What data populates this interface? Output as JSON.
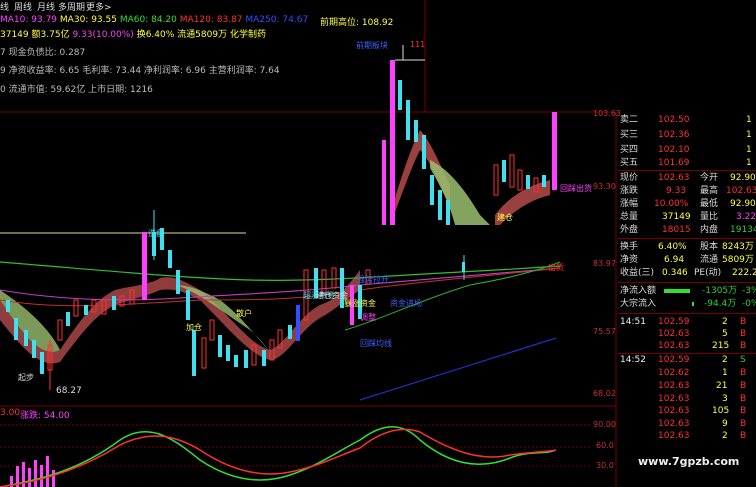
{
  "topbar": {
    "tab_minute": "线",
    "tab_week": "周线",
    "tab_month": "月线",
    "tab_multi": "多周期",
    "tab_more": "更多>"
  },
  "ma_line": {
    "ma10": "MA10: 93.79",
    "ma30": "MA30: 93.55",
    "ma60": "MA60: 84.20",
    "ma120": "MA120: 83.87",
    "ma250": "MA250: 74.67",
    "prev_high": "前期高位: 108.92"
  },
  "info_line": {
    "vol": "37149",
    "amt": "额3.75亿",
    "chg": "9.33(10.00%)",
    "turn": "换6.40%",
    "float": "流通5809万",
    "sector": "化学制药"
  },
  "fin": {
    "line1": "7 现金负债比: 0.287",
    "line2": "9 净资收益率: 6.65 毛利率: 73.44 净利润率: 6.96 主营利润率: 7.64",
    "line3": "0 流通市值: 59.62亿 上市日期: 1216"
  },
  "price_axis": [
    "103.63",
    "93.30",
    "83.97",
    "75.57",
    "68.02"
  ],
  "osc_axis": [
    "90.00",
    "60.0",
    "30.0"
  ],
  "osc_label": {
    "left": "3.00",
    "name": "涨跌: 54.00"
  },
  "low_label": "68.27",
  "peak_label": "111",
  "annotations": {
    "a1": "前期板块",
    "a2": "回踩出货",
    "a3": "建仓",
    "a4": "洗盘",
    "a5": "强势拉升",
    "a6": "出货",
    "a7": "超涨资金",
    "a8": "建仓资金",
    "a9": "资金进场",
    "a10": "暴涨资金",
    "a11": "散户",
    "a12": "回踩均线",
    "a13": "加仓",
    "a14": "调整",
    "a15": "起步"
  },
  "quotes": {
    "asks": [
      {
        "label": "卖二",
        "price": "102.50",
        "vol": "1"
      },
      {
        "label": "买三",
        "price": "102.36",
        "vol": "1"
      },
      {
        "label": "买四",
        "price": "102.10",
        "vol": "1"
      },
      {
        "label": "买五",
        "price": "101.69",
        "vol": "1"
      }
    ],
    "stats": [
      {
        "l1": "现价",
        "v1": "102.63",
        "l2": "今开",
        "v2": "92.90"
      },
      {
        "l1": "涨跌",
        "v1": "9.33",
        "l2": "最高",
        "v2": "102.63"
      },
      {
        "l1": "涨幅",
        "v1": "10.00%",
        "l2": "最低",
        "v2": "92.90"
      },
      {
        "l1": "总量",
        "v1": "37149",
        "l2": "量比",
        "v2": "3.22"
      },
      {
        "l1": "外盘",
        "v1": "18015",
        "l2": "内盘",
        "v2": "19134"
      },
      {
        "l1": "换手",
        "v1": "6.40%",
        "l2": "股本",
        "v2": "8243万"
      },
      {
        "l1": "净资",
        "v1": "6.94",
        "l2": "流通",
        "v2": "5809万"
      },
      {
        "l1": "收益(三)",
        "v1": "0.346",
        "l2": "PE(动)",
        "v2": "222.2"
      }
    ],
    "flow": [
      {
        "label": "净流入额",
        "value": "-1305万",
        "pct": "-3%"
      },
      {
        "label": "大宗流入",
        "value": "-94.4万",
        "pct": "-0%"
      }
    ],
    "ticks1_time": "14:51",
    "ticks1": [
      {
        "price": "102.59",
        "vol": "2",
        "side": "B"
      },
      {
        "price": "102.63",
        "vol": "5",
        "side": "B"
      },
      {
        "price": "102.63",
        "vol": "215",
        "side": "B"
      }
    ],
    "ticks2_time": "14:52",
    "ticks2": [
      {
        "price": "102.59",
        "vol": "2",
        "side": "S"
      },
      {
        "price": "102.62",
        "vol": "1",
        "side": "B"
      },
      {
        "price": "102.63",
        "vol": "21",
        "side": "B"
      },
      {
        "price": "102.63",
        "vol": "3",
        "side": "B"
      },
      {
        "price": "102.63",
        "vol": "105",
        "side": "B"
      },
      {
        "price": "102.63",
        "vol": "9",
        "side": "B"
      },
      {
        "price": "102.63",
        "vol": "2",
        "side": "B"
      }
    ]
  },
  "watermark": "www.7gpzb.com"
}
